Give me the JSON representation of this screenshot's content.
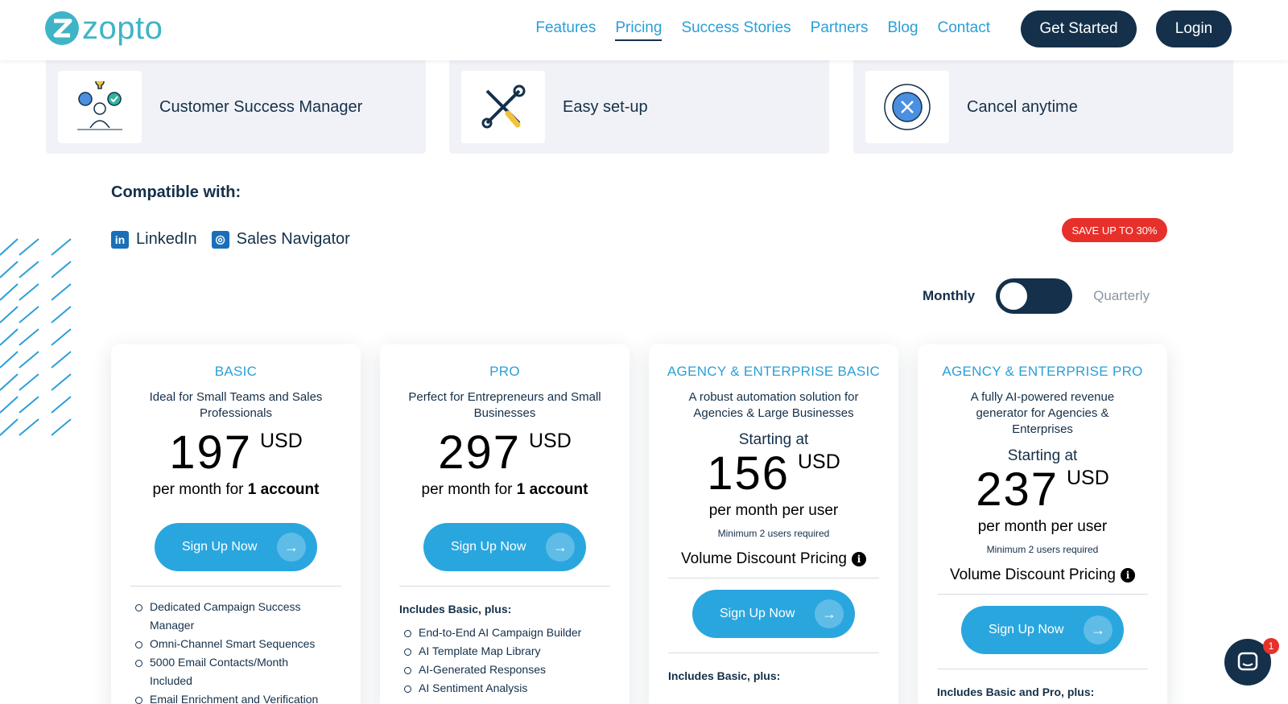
{
  "brand": {
    "name": "zopto"
  },
  "nav": {
    "items": [
      "Features",
      "Pricing",
      "Success Stories",
      "Partners",
      "Blog",
      "Contact"
    ],
    "get_started": "Get Started",
    "login": "Login"
  },
  "features": [
    {
      "label": "Customer Success Manager",
      "icon": "customer-success-icon"
    },
    {
      "label": "Easy set-up",
      "icon": "tools-icon"
    },
    {
      "label": "Cancel anytime",
      "icon": "cancel-icon"
    }
  ],
  "compat": {
    "title": "Compatible with:",
    "items": [
      {
        "label": "LinkedIn",
        "icon": "linkedin-icon"
      },
      {
        "label": "Sales Navigator",
        "icon": "sales-navigator-icon"
      }
    ]
  },
  "billing": {
    "badge": "SAVE UP TO 30%",
    "monthly": "Monthly",
    "quarterly": "Quarterly"
  },
  "plans": [
    {
      "name": "BASIC",
      "desc": "Ideal for Small Teams and Sales Professionals",
      "price": "197",
      "currency": "USD",
      "per_prefix": "per month for ",
      "per_bold": "1 account",
      "cta": "Sign Up Now",
      "features": [
        "Dedicated Campaign Success Manager",
        "Omni-Channel Smart Sequences",
        "5000 Email Contacts/Month Included",
        "Email Enrichment and Verification"
      ]
    },
    {
      "name": "PRO",
      "desc": "Perfect for Entrepreneurs and Small Businesses",
      "price": "297",
      "currency": "USD",
      "per_prefix": "per month for ",
      "per_bold": "1 account",
      "cta": "Sign Up Now",
      "includes": "Includes Basic, plus:",
      "features": [
        "End-to-End AI Campaign Builder",
        "AI Template Map Library",
        "AI-Generated Responses",
        "AI Sentiment Analysis"
      ]
    },
    {
      "name": "AGENCY & ENTERPRISE BASIC",
      "desc": "A robust automation solution for Agencies & Large Businesses",
      "starting": "Starting at",
      "price": "156",
      "currency": "USD",
      "per": "per month per user",
      "min": "Minimum 2 users required",
      "volume": "Volume Discount Pricing",
      "cta": "Sign Up Now",
      "includes": "Includes Basic, plus:"
    },
    {
      "name": "AGENCY & ENTERPRISE PRO",
      "desc": "A fully AI-powered revenue generator for Agencies & Enterprises",
      "starting": "Starting at",
      "price": "237",
      "currency": "USD",
      "per": "per month per user",
      "min": "Minimum 2 users required",
      "volume": "Volume Discount Pricing",
      "cta": "Sign Up Now",
      "includes": "Includes Basic and Pro, plus:"
    }
  ],
  "chat": {
    "badge": "1"
  },
  "colors": {
    "accent": "#2aa6df",
    "navy": "#14304a",
    "brand": "#3fb4c7",
    "badge": "#e8302a"
  }
}
